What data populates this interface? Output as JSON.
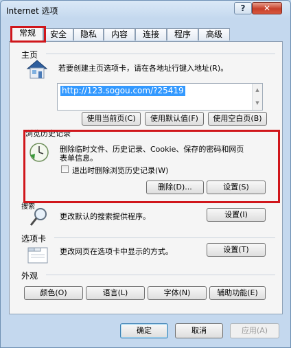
{
  "window": {
    "title": "Internet 选项",
    "help_label": "?",
    "close_label": "✕"
  },
  "tabs": [
    {
      "label": "常规"
    },
    {
      "label": "安全"
    },
    {
      "label": "隐私"
    },
    {
      "label": "内容"
    },
    {
      "label": "连接"
    },
    {
      "label": "程序"
    },
    {
      "label": "高级"
    }
  ],
  "home": {
    "heading": "主页",
    "description": "若要创建主页选项卡，请在各地址行键入地址(R)。",
    "url": "http://123.sogou.com/?25419",
    "use_current": "使用当前页(C)",
    "use_default": "使用默认值(F)",
    "use_blank": "使用空白页(B)"
  },
  "history": {
    "heading": "浏览历史记录",
    "description_line1": "删除临时文件、历史记录、Cookie、保存的密码和网页",
    "description_line2": "表单信息。",
    "checkbox_label": "退出时删除浏览历史记录(W)",
    "delete_button": "删除(D)...",
    "settings_button": "设置(S)"
  },
  "search": {
    "heading": "搜索",
    "description": "更改默认的搜索提供程序。",
    "settings_button": "设置(I)"
  },
  "tabs_section": {
    "heading": "选项卡",
    "description": "更改网页在选项卡中显示的方式。",
    "settings_button": "设置(T)"
  },
  "appearance": {
    "heading": "外观",
    "colors": "颜色(O)",
    "languages": "语言(L)",
    "fonts": "字体(N)",
    "accessibility": "辅助功能(E)"
  },
  "footer": {
    "ok": "确定",
    "cancel": "取消",
    "apply": "应用(A)"
  },
  "colors": {
    "highlight": "#d0161b",
    "url_selection": "#3399ff"
  }
}
